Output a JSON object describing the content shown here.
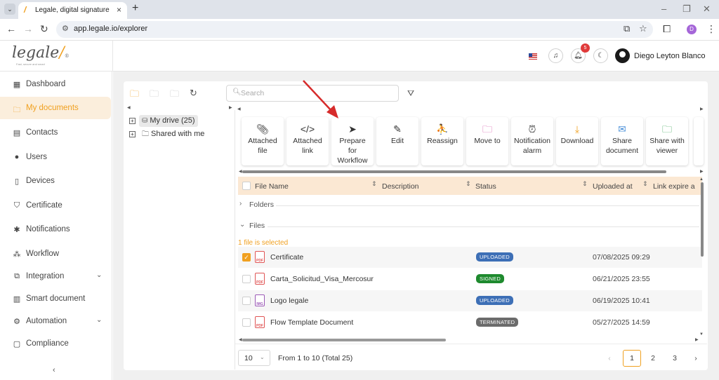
{
  "browser": {
    "tab_title": "Legale, digital signature",
    "url": "app.legale.io/explorer",
    "profile_initial": "D"
  },
  "header": {
    "logo_text": "legale",
    "logo_mark": "/",
    "logo_tagline": "Fast, secure and smart",
    "notification_count": "5",
    "user_name": "Diego Leyton Blanco"
  },
  "sidebar": {
    "items": [
      {
        "label": "Dashboard",
        "icon": "dashboard-icon"
      },
      {
        "label": "My documents",
        "icon": "folder-icon"
      },
      {
        "label": "Contacts",
        "icon": "contacts-icon"
      },
      {
        "label": "Users",
        "icon": "user-icon"
      },
      {
        "label": "Devices",
        "icon": "device-icon"
      },
      {
        "label": "Certificate",
        "icon": "shield-icon"
      },
      {
        "label": "Notifications",
        "icon": "bell-icon"
      },
      {
        "label": "Workflow",
        "icon": "workflow-icon"
      },
      {
        "label": "Integration",
        "icon": "integration-icon"
      },
      {
        "label": "Smart document",
        "icon": "smart-document-icon"
      },
      {
        "label": "Automation",
        "icon": "automation-icon"
      },
      {
        "label": "Compliance",
        "icon": "compliance-icon"
      }
    ],
    "active_index": 1
  },
  "explorer": {
    "search_placeholder": "Search",
    "tree": [
      {
        "label": "My drive (25)",
        "selected": true
      },
      {
        "label": "Shared with me",
        "selected": false
      }
    ],
    "actions": [
      {
        "label1": "Attached",
        "label2": "file",
        "label3": "",
        "icon": "paperclip-icon"
      },
      {
        "label1": "Attached",
        "label2": "link",
        "label3": "",
        "icon": "code-icon"
      },
      {
        "label1": "Prepare",
        "label2": "for",
        "label3": "Workflow",
        "icon": "paper-plane-icon"
      },
      {
        "label1": "Edit",
        "label2": "",
        "label3": "",
        "icon": "edit-icon"
      },
      {
        "label1": "Reassign",
        "label2": "",
        "label3": "",
        "icon": "reassign-icon"
      },
      {
        "label1": "Move to",
        "label2": "",
        "label3": "",
        "icon": "move-folder-icon"
      },
      {
        "label1": "Notification",
        "label2": "alarm",
        "label3": "",
        "icon": "alarm-clock-icon"
      },
      {
        "label1": "Download",
        "label2": "",
        "label3": "",
        "icon": "download-icon"
      },
      {
        "label1": "Share",
        "label2": "document",
        "label3": "",
        "icon": "envelope-icon"
      },
      {
        "label1": "Share with",
        "label2": "viewer",
        "label3": "",
        "icon": "share-viewer-icon"
      }
    ],
    "columns": [
      "File Name",
      "Description",
      "Status",
      "Uploaded at",
      "Link expire a"
    ],
    "groups": {
      "folders": "Folders",
      "files": "Files"
    },
    "selection_note": "1 file is selected",
    "rows": [
      {
        "name": "Certificate",
        "status": "UPLOADED",
        "status_color": "#3d6fb6",
        "uploaded": "07/08/2025 09:29",
        "checked": true,
        "type": "PDF"
      },
      {
        "name": "Carta_Solicitud_Visa_Mercosur",
        "status": "SIGNED",
        "status_color": "#1e8a2e",
        "uploaded": "06/21/2025 23:55",
        "checked": false,
        "type": "PDF"
      },
      {
        "name": "Logo legale",
        "status": "UPLOADED",
        "status_color": "#3d6fb6",
        "uploaded": "06/19/2025 10:41",
        "checked": false,
        "type": "IMG"
      },
      {
        "name": "Flow Template Document",
        "status": "TERMINATED",
        "status_color": "#6b6b6b",
        "uploaded": "05/27/2025 14:59",
        "checked": false,
        "type": "PDF"
      }
    ],
    "pagination": {
      "page_size": "10",
      "range_text": "From 1 to 10 (Total 25)",
      "pages": [
        "1",
        "2",
        "3"
      ],
      "current_page": "1"
    }
  },
  "colors": {
    "accent": "#f0a020",
    "annotation_arrow": "#d62b2b"
  }
}
